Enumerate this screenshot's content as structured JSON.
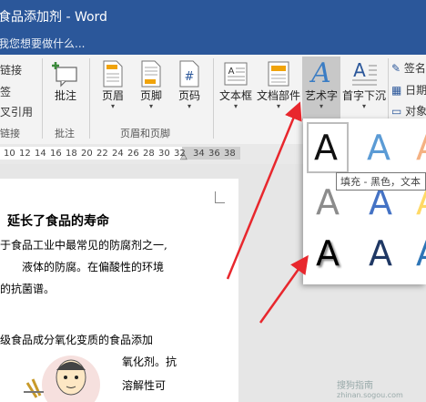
{
  "window": {
    "title": "食品添加剂 - Word"
  },
  "tell_me": {
    "placeholder": "我您想要做什么..."
  },
  "ribbon": {
    "links_group": {
      "items": [
        "链接",
        "签",
        "叉引用"
      ],
      "group_label": "链接"
    },
    "comment_group": {
      "button_label": "批注",
      "group_label": "批注"
    },
    "header_footer_group": {
      "buttons": [
        {
          "label": "页眉",
          "icon": "header-icon"
        },
        {
          "label": "页脚",
          "icon": "footer-icon"
        },
        {
          "label": "页码",
          "icon": "page-number-icon"
        }
      ],
      "group_label": "页眉和页脚"
    },
    "text_group": {
      "buttons": [
        {
          "label": "文本框",
          "icon": "text-box-icon"
        },
        {
          "label": "文档部件",
          "icon": "quick-parts-icon"
        },
        {
          "label": "艺术字",
          "icon": "wordart-icon"
        },
        {
          "label": "首字下沉",
          "icon": "drop-cap-icon"
        }
      ],
      "side_items": [
        "签名",
        "日期",
        "对象"
      ]
    }
  },
  "ruler": {
    "ticks": [
      "10",
      "12",
      "14",
      "16",
      "18",
      "20",
      "22",
      "24",
      "26",
      "28",
      "30",
      "32",
      "",
      "34",
      "36",
      "38"
    ]
  },
  "document": {
    "title": "延长了食品的寿命",
    "lines": [
      "于食品工业中最常见的防腐剂之一,",
      "液体的防腐。在偏酸性的环境",
      "的抗菌谱。",
      "级食品成分氧化变质的食品添加",
      "氧化剂。抗",
      "溶解性可"
    ]
  },
  "wordart_gallery": {
    "tooltip": "填充 - 黑色，文本",
    "glyph": "A",
    "styles": [
      {
        "name": "fill-black",
        "color": "#111111"
      },
      {
        "name": "fill-blue-gradient",
        "color": "#5b9bd5"
      },
      {
        "name": "fill-orange",
        "color": "#f4b183"
      },
      {
        "name": "fill-gray",
        "color": "#8c8c8c"
      },
      {
        "name": "fill-blue-outline",
        "color": "#4472c4"
      },
      {
        "name": "fill-gold",
        "color": "#ffd966"
      },
      {
        "name": "fill-black-shadow",
        "color": "#000000"
      },
      {
        "name": "fill-dark-blue",
        "color": "#1f3864"
      },
      {
        "name": "fill-blue-light",
        "color": "#2e75b6"
      }
    ]
  },
  "watermark": {
    "text": "搜狗指南",
    "url_text": "zhinan.sogou.com"
  },
  "colors": {
    "title_bar": "#2b579a",
    "ribbon_bg": "#f3f3f3",
    "annotation_arrow": "#e8272d"
  }
}
